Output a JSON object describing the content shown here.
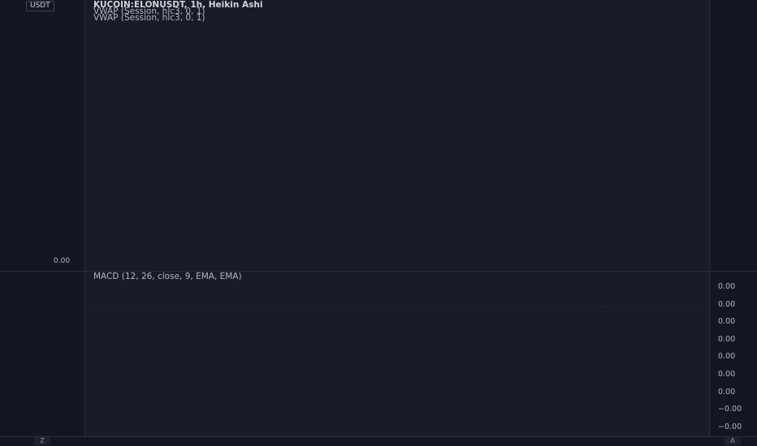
{
  "left_scale": {
    "currency": "USDT",
    "zero_label": "0.00"
  },
  "main_legend": {
    "title": "KUCOIN:ELONUSDT, 1h, Heikin Ashi",
    "vwap_1": "VWAP (Session, hlc3, 0, 1)",
    "vwap_2": "VWAP (Session, hlc3, 0, 1)"
  },
  "macd_legend": {
    "title": "MACD (12, 26, close, 9, EMA, EMA)"
  },
  "macd_scale": {
    "labels": [
      "0.00",
      "0.00",
      "0.00",
      "0.00",
      "0.00",
      "0.00",
      "0.00",
      "−0.00",
      "−0.00"
    ]
  },
  "bottom": {
    "left_button": "Z",
    "right_button": "A"
  },
  "colors": {
    "background": "#161a25",
    "pane": "#181c27",
    "border": "#2a2e39",
    "text": "#b2b5be"
  }
}
